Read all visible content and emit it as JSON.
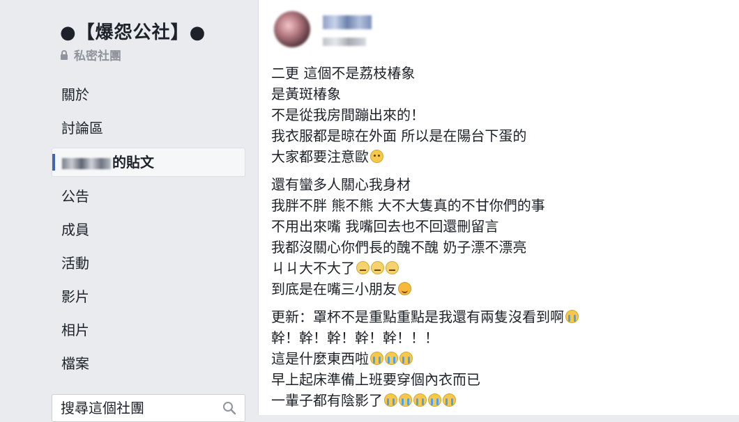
{
  "group": {
    "title": "●【爆怨公社】●",
    "privacy": "私密社團"
  },
  "sidebar": {
    "items": [
      {
        "label": "關於"
      },
      {
        "label": "討論區"
      },
      {
        "label": "的貼文"
      },
      {
        "label": "公告"
      },
      {
        "label": "成員"
      },
      {
        "label": "活動"
      },
      {
        "label": "影片"
      },
      {
        "label": "相片"
      },
      {
        "label": "檔案"
      }
    ],
    "active_index": 2
  },
  "search": {
    "placeholder": "搜尋這個社團"
  },
  "post": {
    "paragraphs": [
      {
        "lines": [
          {
            "text": "二更 這個不是荔枝椿象",
            "emojis": []
          },
          {
            "text": "是黃斑椿象",
            "emojis": []
          },
          {
            "text": "不是從我房間蹦出來的！",
            "emojis": []
          },
          {
            "text": "我衣服都是晾在外面 所以是在陽台下蛋的",
            "emojis": []
          },
          {
            "text": "大家都要注意歐",
            "emojis": [
              "sad-face"
            ]
          }
        ]
      },
      {
        "lines": [
          {
            "text": "還有蠻多人關心我身材",
            "emojis": []
          },
          {
            "text": "我胖不胖 熊不熊 大不大隻真的不甘你們的事",
            "emojis": []
          },
          {
            "text": "不用出來嘴 我嘴回去也不回還刪留言",
            "emojis": []
          },
          {
            "text": "我都沒關心你們長的醜不醜 奶子漂不漂亮",
            "emojis": []
          },
          {
            "text": "ㄐㄐ大不大了",
            "emojis": [
              "unamused-face",
              "unamused-face",
              "unamused-face"
            ]
          },
          {
            "text": "到底是在嘴三小朋友",
            "emojis": [
              "smiling-face"
            ]
          }
        ]
      },
      {
        "lines": [
          {
            "text": "更新：罩杯不是重點重點是我還有兩隻沒看到啊",
            "emojis": [
              "crying-face"
            ]
          },
          {
            "text": "幹！幹！幹！幹！幹！！！",
            "emojis": []
          },
          {
            "text": "這是什麼東西啦",
            "emojis": [
              "crying-face",
              "crying-face",
              "crying-face"
            ]
          },
          {
            "text": "早上起床準備上班要穿個內衣而已",
            "emojis": []
          },
          {
            "text": "一輩子都有陰影了",
            "emojis": [
              "crying-face",
              "crying-face",
              "crying-face",
              "crying-face",
              "crying-face"
            ]
          }
        ]
      }
    ]
  },
  "colors": {
    "background": "#e9ebee",
    "card": "#ffffff",
    "text": "#1d2129",
    "muted": "#90949c",
    "accent": "#4267b2"
  }
}
